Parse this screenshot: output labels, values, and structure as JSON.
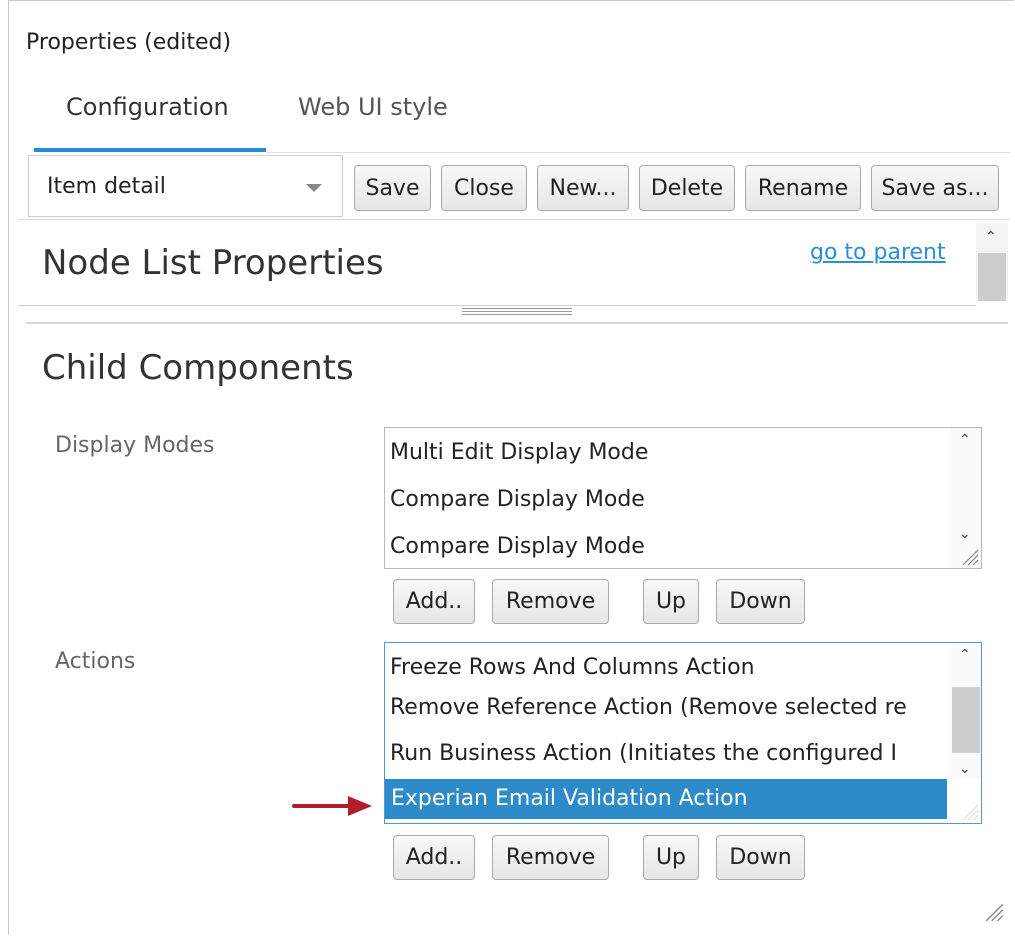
{
  "window": {
    "title": "Properties (edited)"
  },
  "tabs": [
    {
      "label": "Configuration",
      "active": true
    },
    {
      "label": "Web UI style",
      "active": false
    }
  ],
  "toolbar": {
    "view_select": "Item detail",
    "save": "Save",
    "close": "Close",
    "new": "New...",
    "delete": "Delete",
    "rename": "Rename",
    "save_as": "Save as..."
  },
  "header": {
    "title": "Node List Properties",
    "parent_link": "go to parent"
  },
  "section": {
    "title": "Child Components"
  },
  "display_modes": {
    "label": "Display Modes",
    "items": [
      "Multi Edit Display Mode",
      "Compare Display Mode",
      "Compare Display Mode"
    ],
    "buttons": {
      "add": "Add..",
      "remove": "Remove",
      "up": "Up",
      "down": "Down"
    }
  },
  "actions": {
    "label": "Actions",
    "items": [
      "Freeze Rows And Columns Action",
      "Remove Reference Action (Remove selected re",
      "Run Business Action (Initiates the configured I",
      "Experian Email Validation Action"
    ],
    "selected_index": 3,
    "buttons": {
      "add": "Add..",
      "remove": "Remove",
      "up": "Up",
      "down": "Down"
    }
  },
  "colors": {
    "accent": "#1e8fd6",
    "link": "#2a8fd9",
    "selection": "#2e8bc9",
    "annotation_arrow": "#b01e2a"
  }
}
